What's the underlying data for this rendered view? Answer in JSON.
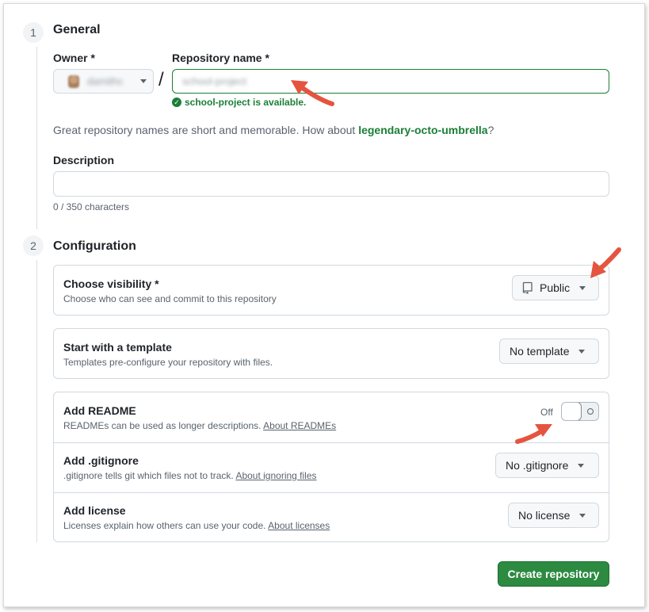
{
  "general": {
    "step": "1",
    "title": "General",
    "owner_label": "Owner *",
    "owner_value": "damithc",
    "repo_label": "Repository name *",
    "repo_value": "school-project",
    "availability": "school-project is available.",
    "suggestion_prefix": "Great repository names are short and memorable. How about ",
    "suggestion_name": "legendary-octo-umbrella",
    "suggestion_suffix": "?",
    "description_label": "Description",
    "description_value": "",
    "char_count": "0 / 350 characters"
  },
  "configuration": {
    "step": "2",
    "title": "Configuration",
    "visibility": {
      "title": "Choose visibility *",
      "subtitle": "Choose who can see and commit to this repository",
      "value": "Public"
    },
    "template": {
      "title": "Start with a template",
      "subtitle": "Templates pre-configure your repository with files.",
      "value": "No template"
    },
    "readme": {
      "title": "Add README",
      "subtitle": "READMEs can be used as longer descriptions.",
      "link": "About READMEs",
      "toggle_label": "Off"
    },
    "gitignore": {
      "title": "Add .gitignore",
      "subtitle": ".gitignore tells git which files not to track.",
      "link": "About ignoring files",
      "value": "No .gitignore"
    },
    "license": {
      "title": "Add license",
      "subtitle": "Licenses explain how others can use your code.",
      "link": "About licenses",
      "value": "No license"
    }
  },
  "create_button": "Create repository",
  "colors": {
    "accent_green": "#1a7f37",
    "button_green": "#2c8a41",
    "annotation_arrow": "#e5543f"
  },
  "icons": [
    "check-circle-icon",
    "repo-icon",
    "chevron-down-icon",
    "annotation-arrow"
  ]
}
